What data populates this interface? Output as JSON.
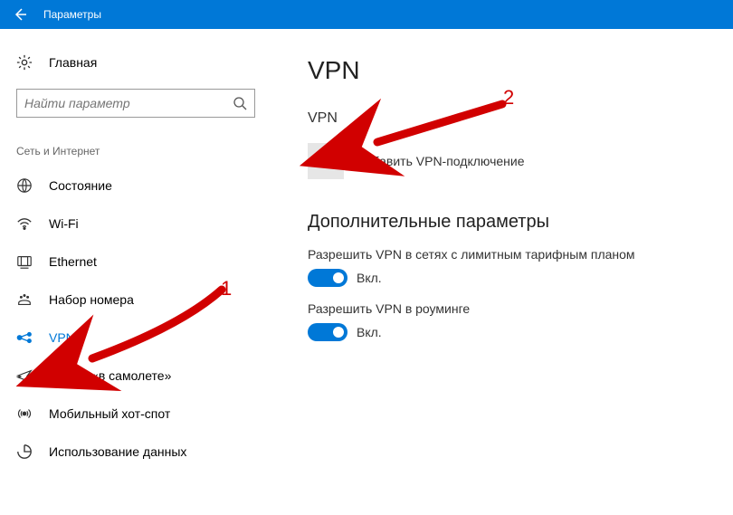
{
  "window": {
    "title": "Параметры"
  },
  "sidebar": {
    "home_label": "Главная",
    "search_placeholder": "Найти параметр",
    "group_label": "Сеть и Интернет",
    "items": [
      {
        "label": "Состояние",
        "icon": "globe-icon",
        "active": false
      },
      {
        "label": "Wi-Fi",
        "icon": "wifi-icon",
        "active": false
      },
      {
        "label": "Ethernet",
        "icon": "ethernet-icon",
        "active": false
      },
      {
        "label": "Набор номера",
        "icon": "dialup-icon",
        "active": false
      },
      {
        "label": "VPN",
        "icon": "vpn-icon",
        "active": true
      },
      {
        "label": "Режим «в самолете»",
        "icon": "airplane-icon",
        "active": false
      },
      {
        "label": "Мобильный хот-спот",
        "icon": "hotspot-icon",
        "active": false
      },
      {
        "label": "Использование данных",
        "icon": "data-usage-icon",
        "active": false
      }
    ]
  },
  "main": {
    "page_title": "VPN",
    "vpn_section": "VPN",
    "add_vpn_label": "Добавить VPN-подключение",
    "advanced_title": "Дополнительные параметры",
    "settings": [
      {
        "label": "Разрешить VPN в сетях с лимитным тарифным планом",
        "state": "Вкл.",
        "on": true
      },
      {
        "label": "Разрешить VPN в роуминге",
        "state": "Вкл.",
        "on": true
      }
    ]
  },
  "annotations": {
    "num1": "1",
    "num2": "2",
    "arrow_color": "#d10000"
  }
}
